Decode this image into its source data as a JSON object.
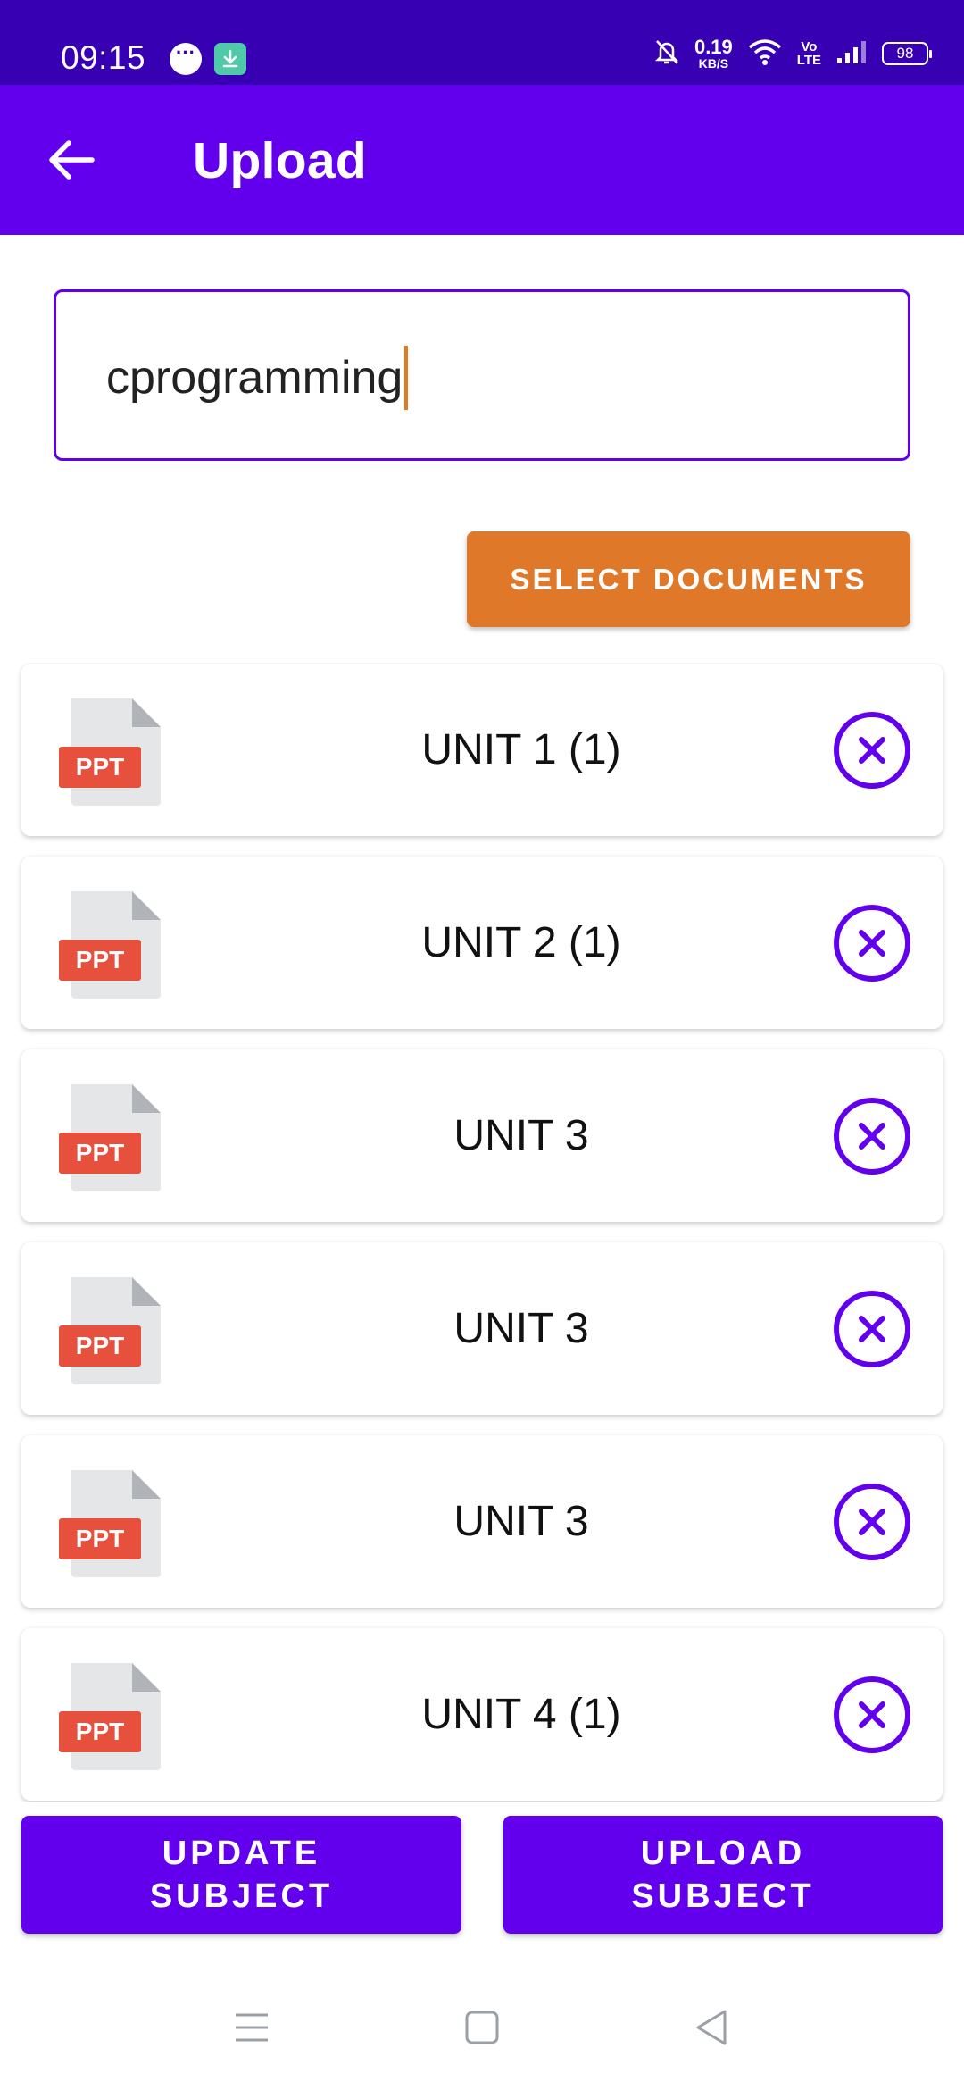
{
  "status_bar": {
    "time": "09:15",
    "net_speed_value": "0.19",
    "net_speed_unit": "KB/S",
    "volte_top": "Vo",
    "volte_bottom": "LTE",
    "battery": "98"
  },
  "toolbar": {
    "title": "Upload",
    "back_icon": "arrow-left-icon"
  },
  "subject_input": {
    "value": "cprogramming"
  },
  "select_documents_label": "SELECT DOCUMENTS",
  "documents": [
    {
      "badge": "PPT",
      "name": "UNIT 1 (1)"
    },
    {
      "badge": "PPT",
      "name": "UNIT 2 (1)"
    },
    {
      "badge": "PPT",
      "name": "UNIT 3"
    },
    {
      "badge": "PPT",
      "name": "UNIT 3"
    },
    {
      "badge": "PPT",
      "name": "UNIT 3"
    },
    {
      "badge": "PPT",
      "name": "UNIT 4 (1)"
    }
  ],
  "actions": {
    "update_line1": "UPDATE",
    "update_line2": "SUBJECT",
    "upload_line1": "UPLOAD",
    "upload_line2": "SUBJECT"
  },
  "colors": {
    "status_bar": "#3700b3",
    "primary": "#6200ee",
    "accent": "#e0782a",
    "ppt_badge": "#e8503e"
  }
}
